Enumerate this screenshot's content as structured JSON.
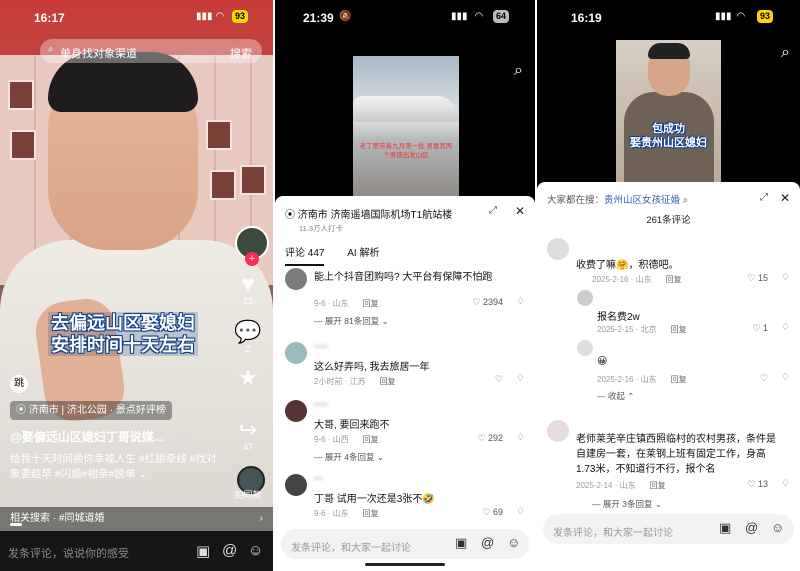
{
  "panel1": {
    "time": "16:17",
    "battery": "93",
    "search_placeholder": "单身找对象渠道",
    "search_button": "搜索",
    "caption_line1": "去偏远山区娶媳妇",
    "caption_line2": "安排时间十天左右",
    "likes": "23",
    "comments": "2",
    "shares": "47",
    "follow_label": "拍同款",
    "location_city": "济南市",
    "location_place": "济北公园",
    "location_tag": "景点好评榜",
    "username": "@娶偏远山区媳妇丁哥说媒...",
    "posted": "2天前",
    "description": "给我十天时间换你幸福人生 #红娘牵线 #找对象要趁早 #闪婚#相亲#脱单",
    "description_more": "⌄",
    "author_note": "作者声明：个人观点，仅供参考",
    "related_label": "相关搜索",
    "related_query": "#同城道婚",
    "comment_placeholder": "发条评论，说说你的感受",
    "badge": "跳"
  },
  "panel2": {
    "time": "21:39",
    "battery": "64",
    "video_caption": "老丁要带着九月第一批 男嘉宾两个男孩出发山区",
    "location_city": "济南市",
    "location_place": "济南遥墙国际机场T1航站楼",
    "location_visits": "11.3万人打卡",
    "tab_comments": "评论 447",
    "tab_ai": "AI 解析",
    "comments": [
      {
        "text": "能上个抖音团购吗? 大平台有保障不怕跑",
        "date": "9-6",
        "place": "山东",
        "reply": "回复",
        "likes": "2394",
        "more": "展开 81条回复"
      },
      {
        "text": "这么好弄吗, 我去旅居一年",
        "date": "2小时前",
        "place": "江苏",
        "reply": "回复",
        "likes": "",
        "more": ""
      },
      {
        "text": "大哥, 要回来跑不",
        "date": "9-6",
        "place": "山西",
        "reply": "回复",
        "likes": "292",
        "more": "展开 4条回复"
      },
      {
        "text": "丁哥 试用一次还是3张不🤣",
        "date": "9-6",
        "place": "山东",
        "reply": "回复",
        "likes": "69",
        "more": ""
      }
    ],
    "comment_placeholder": "发条评论，和大家一起讨论"
  },
  "panel3": {
    "time": "16:19",
    "battery": "93",
    "video_caption_line1": "包成功",
    "video_caption_line2": "娶贵州山区媳妇",
    "search_prefix": "大家都在搜：",
    "search_link": "贵州山区女孩征婚",
    "comment_count": "261条评论",
    "comments": [
      {
        "text": "收费了嘛🤗，积德吧。",
        "date": "2025-2-16",
        "place": "山东",
        "reply": "回复",
        "likes": "15"
      },
      {
        "text": "报名费2w",
        "date": "2025-2-15",
        "place": "北京",
        "reply": "回复",
        "likes": "1"
      },
      {
        "text": "😀",
        "date": "2025-2-16",
        "place": "山东",
        "reply": "回复",
        "likes": ""
      },
      {
        "text": "老师莱芜辛庄镇西照临村的农村男孩，条件是自建房一套，在莱钢上班有固定工作，身高1.73米，不知道行不行，报个名",
        "date": "2025-2-14",
        "place": "山东",
        "reply": "回复",
        "likes": "13"
      }
    ],
    "collapse_label": "收起",
    "expand_label": "展开 3条回复",
    "comment_placeholder": "发条评论，和大家一起讨论"
  }
}
